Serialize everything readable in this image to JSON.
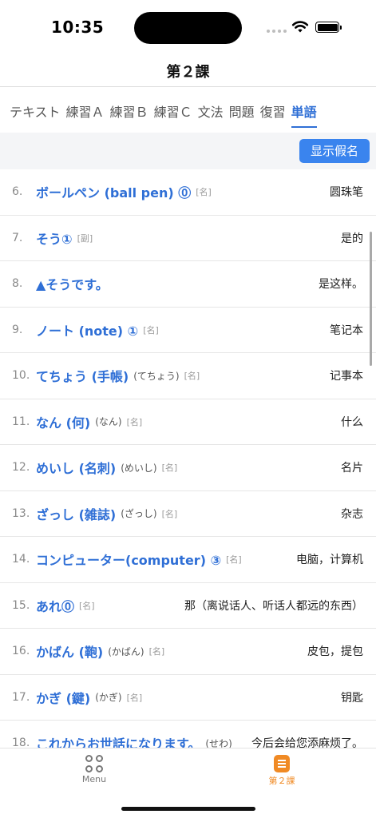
{
  "status_bar": {
    "time": "10:35"
  },
  "nav": {
    "title": "第２課"
  },
  "tabs": [
    {
      "label": "テキスト",
      "active": false
    },
    {
      "label": "練習Ａ",
      "active": false
    },
    {
      "label": "練習Ｂ",
      "active": false
    },
    {
      "label": "練習Ｃ",
      "active": false
    },
    {
      "label": "文法",
      "active": false
    },
    {
      "label": "問題",
      "active": false
    },
    {
      "label": "復習",
      "active": false
    },
    {
      "label": "単語",
      "active": true
    }
  ],
  "toolbar": {
    "show_kana_label": "显示假名"
  },
  "vocab": [
    {
      "num": "6.",
      "word": "ボールペン (ball pen) ⓪",
      "reading": "",
      "pos": "[名]",
      "meaning": "圆珠笔"
    },
    {
      "num": "7.",
      "word": "そう①",
      "reading": "",
      "pos": "[副]",
      "meaning": "是的"
    },
    {
      "num": "8.",
      "word": "▲そうです。",
      "reading": "",
      "pos": "",
      "meaning": "是这样。"
    },
    {
      "num": "9.",
      "word": "ノート (note) ①",
      "reading": "",
      "pos": "[名]",
      "meaning": "笔记本"
    },
    {
      "num": "10.",
      "word": "てちょう (手帳)",
      "reading": "(てちょう)",
      "pos": "[名]",
      "meaning": "记事本"
    },
    {
      "num": "11.",
      "word": "なん (何)",
      "reading": "(なん)",
      "pos": "[名]",
      "meaning": "什么"
    },
    {
      "num": "12.",
      "word": "めいし (名刺)",
      "reading": "(めいし)",
      "pos": "[名]",
      "meaning": "名片"
    },
    {
      "num": "13.",
      "word": "ざっし (雑誌)",
      "reading": "(ざっし)",
      "pos": "[名]",
      "meaning": "杂志"
    },
    {
      "num": "14.",
      "word": "コンピューター(computer) ③",
      "reading": "",
      "pos": "[名]",
      "meaning": "电脑，计算机"
    },
    {
      "num": "15.",
      "word": "あれ⓪",
      "reading": "",
      "pos": "[名]",
      "meaning": "那（离说话人、听话人都远的东西）"
    },
    {
      "num": "16.",
      "word": "かばん (鞄)",
      "reading": "(かばん)",
      "pos": "[名]",
      "meaning": "皮包，提包"
    },
    {
      "num": "17.",
      "word": "かぎ (鍵)",
      "reading": "(かぎ)",
      "pos": "[名]",
      "meaning": "钥匙"
    },
    {
      "num": "18.",
      "word": "これからお世話になります。",
      "reading": "(せわ)",
      "pos": "",
      "meaning": "今后会给您添麻烦了。"
    }
  ],
  "tabbar": {
    "menu_label": "Menu",
    "lesson_label": "第２課",
    "active_color": "#f08a24"
  },
  "colors": {
    "accent": "#2f6fd6",
    "button": "#3a84ee"
  }
}
